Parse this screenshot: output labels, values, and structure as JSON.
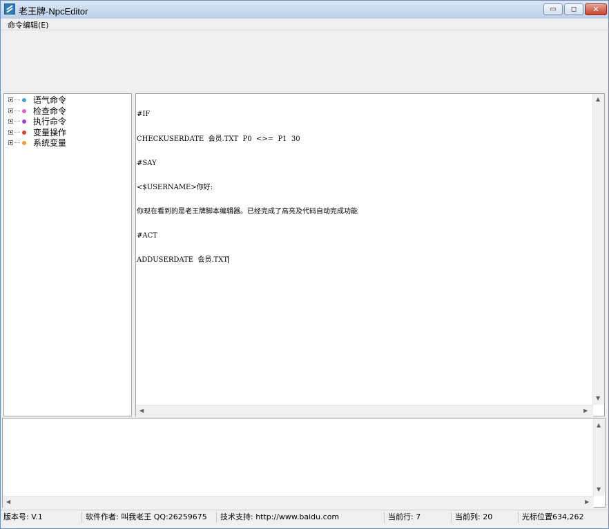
{
  "window": {
    "title": "老王牌-NpcEditor",
    "controls": {
      "minimize": "▭",
      "maximize": "◻",
      "close": "✕"
    }
  },
  "menu": {
    "items": [
      "命令编辑(E)"
    ]
  },
  "tree": {
    "items": [
      {
        "label": "语气命令",
        "color": "#3aa4d8"
      },
      {
        "label": "检查命令",
        "color": "#e060c8"
      },
      {
        "label": "执行命令",
        "color": "#9a40d8"
      },
      {
        "label": "变量操作",
        "color": "#e03a3a"
      },
      {
        "label": "系统变量",
        "color": "#e8a030"
      }
    ]
  },
  "editor": {
    "lines": [
      "#IF",
      "CHECKUSERDATE  会员.TXT  P0  <>=  P1  30",
      "#SAY",
      "<$USERNAME>你好:",
      "你现在看到的是老王牌脚本编辑器。已经完成了高亮及代码自动完成功能",
      "#ACT",
      "ADDUSERDATE  会员.TXT"
    ]
  },
  "status": {
    "version": "版本号: V.1",
    "author": "软件作者: 叫我老王 QQ:26259675",
    "support": "技术支持: http://www.baidu.com",
    "row": "当前行: 7",
    "col": "当前列: 20",
    "cursor": "光标位置634,262"
  }
}
